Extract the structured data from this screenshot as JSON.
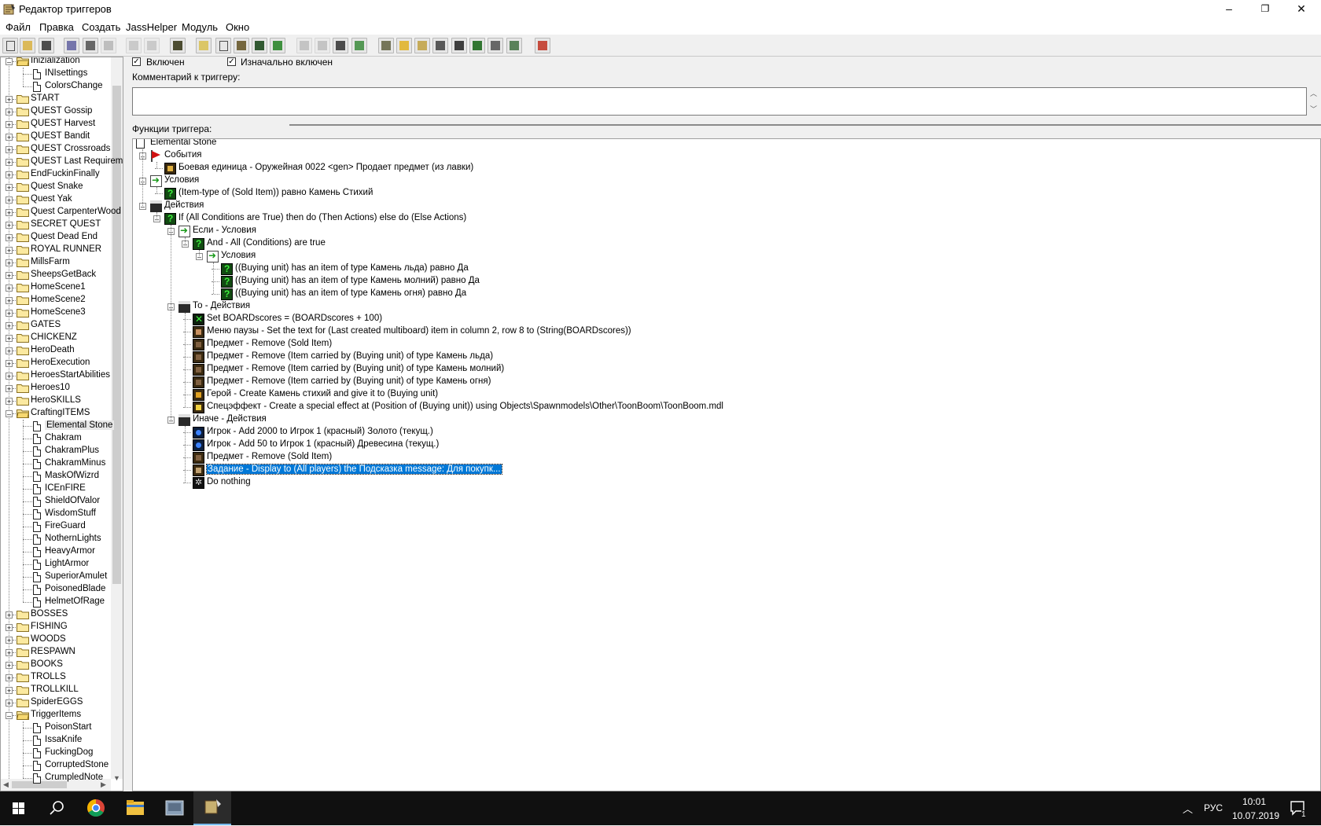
{
  "window": {
    "title": "Редактор триггеров",
    "min": "–",
    "max": "❐",
    "close": "✕"
  },
  "menu": [
    "Файл",
    "Правка",
    "Создать",
    "JassHelper",
    "Модуль",
    "Окно"
  ],
  "left_tree": {
    "items": [
      {
        "label": "Inizialization",
        "type": "folder",
        "depth": 0,
        "expanded": true
      },
      {
        "label": "INIsettings",
        "type": "doc",
        "depth": 1
      },
      {
        "label": "ColorsChange",
        "type": "doc",
        "depth": 1
      },
      {
        "label": "START",
        "type": "folder",
        "depth": 0
      },
      {
        "label": "QUEST Gossip",
        "type": "folder",
        "depth": 0
      },
      {
        "label": "QUEST Harvest",
        "type": "folder",
        "depth": 0
      },
      {
        "label": "QUEST Bandit",
        "type": "folder",
        "depth": 0
      },
      {
        "label": "QUEST Crossroads",
        "type": "folder",
        "depth": 0
      },
      {
        "label": "QUEST Last Requirement",
        "type": "folder",
        "depth": 0
      },
      {
        "label": "EndFuckinFinally",
        "type": "folder",
        "depth": 0
      },
      {
        "label": "Quest Snake",
        "type": "folder",
        "depth": 0
      },
      {
        "label": "Quest Yak",
        "type": "folder",
        "depth": 0
      },
      {
        "label": "Quest CarpenterWood",
        "type": "folder",
        "depth": 0
      },
      {
        "label": "SECRET QUEST",
        "type": "folder",
        "depth": 0
      },
      {
        "label": "Quest Dead End",
        "type": "folder",
        "depth": 0
      },
      {
        "label": "ROYAL RUNNER",
        "type": "folder",
        "depth": 0
      },
      {
        "label": "MillsFarm",
        "type": "folder",
        "depth": 0
      },
      {
        "label": "SheepsGetBack",
        "type": "folder",
        "depth": 0
      },
      {
        "label": "HomeScene1",
        "type": "folder",
        "depth": 0
      },
      {
        "label": "HomeScene2",
        "type": "folder",
        "depth": 0
      },
      {
        "label": "HomeScene3",
        "type": "folder",
        "depth": 0
      },
      {
        "label": "GATES",
        "type": "folder",
        "depth": 0
      },
      {
        "label": "CHICKENZ",
        "type": "folder",
        "depth": 0
      },
      {
        "label": "HeroDeath",
        "type": "folder",
        "depth": 0
      },
      {
        "label": "HeroExecution",
        "type": "folder",
        "depth": 0
      },
      {
        "label": "HeroesStartAbilities",
        "type": "folder",
        "depth": 0
      },
      {
        "label": "Heroes10",
        "type": "folder",
        "depth": 0
      },
      {
        "label": "HeroSKILLS",
        "type": "folder",
        "depth": 0
      },
      {
        "label": "CraftingITEMS",
        "type": "folder",
        "depth": 0,
        "expanded": true
      },
      {
        "label": "Elemental Stone",
        "type": "doc",
        "depth": 1,
        "selected": true
      },
      {
        "label": "Chakram",
        "type": "doc",
        "depth": 1
      },
      {
        "label": "ChakramPlus",
        "type": "doc",
        "depth": 1
      },
      {
        "label": "ChakramMinus",
        "type": "doc",
        "depth": 1
      },
      {
        "label": "MaskOfWizrd",
        "type": "doc",
        "depth": 1
      },
      {
        "label": "ICEnFIRE",
        "type": "doc",
        "depth": 1
      },
      {
        "label": "ShieldOfValor",
        "type": "doc",
        "depth": 1
      },
      {
        "label": "WisdomStuff",
        "type": "doc",
        "depth": 1
      },
      {
        "label": "FireGuard",
        "type": "doc",
        "depth": 1
      },
      {
        "label": "NothernLights",
        "type": "doc",
        "depth": 1
      },
      {
        "label": "HeavyArmor",
        "type": "doc",
        "depth": 1
      },
      {
        "label": "LightArmor",
        "type": "doc",
        "depth": 1
      },
      {
        "label": "SuperiorAmulet",
        "type": "doc",
        "depth": 1
      },
      {
        "label": "PoisonedBlade",
        "type": "doc",
        "depth": 1
      },
      {
        "label": "HelmetOfRage",
        "type": "doc",
        "depth": 1
      },
      {
        "label": "BOSSES",
        "type": "folder",
        "depth": 0
      },
      {
        "label": "FISHING",
        "type": "folder",
        "depth": 0
      },
      {
        "label": "WOODS",
        "type": "folder",
        "depth": 0
      },
      {
        "label": "RESPAWN",
        "type": "folder",
        "depth": 0
      },
      {
        "label": "BOOKS",
        "type": "folder",
        "depth": 0
      },
      {
        "label": "TROLLS",
        "type": "folder",
        "depth": 0
      },
      {
        "label": "TROLLKILL",
        "type": "folder",
        "depth": 0
      },
      {
        "label": "SpiderEGGS",
        "type": "folder",
        "depth": 0
      },
      {
        "label": "TriggerItems",
        "type": "folder",
        "depth": 0,
        "expanded": true
      },
      {
        "label": "PoisonStart",
        "type": "doc",
        "depth": 1
      },
      {
        "label": "IssaKnife",
        "type": "doc",
        "depth": 1
      },
      {
        "label": "FuckingDog",
        "type": "doc",
        "depth": 1
      },
      {
        "label": "CorruptedStone",
        "type": "doc",
        "depth": 1
      },
      {
        "label": "CrumpledNote",
        "type": "doc",
        "depth": 1
      }
    ]
  },
  "trigger": {
    "enabled_label": "Включен",
    "initially_enabled_label": "Изначально включен",
    "comment_label": "Комментарий к триггеру:",
    "functions_label": "Функции триггера:"
  },
  "functions": [
    {
      "label": "Elemental Stone",
      "icon": "doc",
      "depth": 0
    },
    {
      "label": "События",
      "icon": "flag",
      "depth": 1,
      "expander": "–"
    },
    {
      "label": "Боевая единица - Оружейная 0022 <gen> Продает предмет (из лавки)",
      "icon": "dark",
      "color": "#e0b040",
      "depth": 2
    },
    {
      "label": "Условия",
      "icon": "cond",
      "depth": 1,
      "expander": "–"
    },
    {
      "label": "(Item-type of (Sold Item)) равно Камень Стихий",
      "icon": "green",
      "depth": 2
    },
    {
      "label": "Действия",
      "icon": "clap",
      "depth": 1,
      "expander": "–"
    },
    {
      "label": "If (All Conditions are True) then do (Then Actions) else do (Else Actions)",
      "icon": "green",
      "depth": 2,
      "expander": "–"
    },
    {
      "label": "Если - Условия",
      "icon": "cond",
      "depth": 3,
      "expander": "–"
    },
    {
      "label": "And - All (Conditions) are true",
      "icon": "green",
      "depth": 4,
      "expander": "–"
    },
    {
      "label": "Условия",
      "icon": "cond",
      "depth": 5,
      "expander": "–"
    },
    {
      "label": "((Buying unit) has an item of type Камень льда) равно Да",
      "icon": "green",
      "depth": 6
    },
    {
      "label": "((Buying unit) has an item of type Камень молний) равно Да",
      "icon": "green",
      "depth": 6
    },
    {
      "label": "((Buying unit) has an item of type Камень огня) равно Да",
      "icon": "green",
      "depth": 6
    },
    {
      "label": "То - Действия",
      "icon": "clap",
      "depth": 3,
      "expander": "–"
    },
    {
      "label": "Set BOARDscores = (BOARDscores + 100)",
      "icon": "setv",
      "depth": 4
    },
    {
      "label": "Меню паузы - Set the text for (Last created multiboard) item in column 2, row 8 to (String(BOARDscores))",
      "icon": "dark",
      "color": "#c89060",
      "depth": 4
    },
    {
      "label": "Предмет - Remove (Sold Item)",
      "icon": "dark",
      "color": "#806040",
      "depth": 4
    },
    {
      "label": "Предмет - Remove (Item carried by (Buying unit) of type Камень льда)",
      "icon": "dark",
      "color": "#806040",
      "depth": 4
    },
    {
      "label": "Предмет - Remove (Item carried by (Buying unit) of type Камень молний)",
      "icon": "dark",
      "color": "#806040",
      "depth": 4
    },
    {
      "label": "Предмет - Remove (Item carried by (Buying unit) of type Камень огня)",
      "icon": "dark",
      "color": "#806040",
      "depth": 4
    },
    {
      "label": "Герой - Create Камень стихий and give it to (Buying unit)",
      "icon": "dark",
      "color": "#e0a020",
      "depth": 4
    },
    {
      "label": "Спецэффект - Create a special effect at (Position of (Buying unit)) using Objects\\Spawnmodels\\Other\\ToonBoom\\ToonBoom.mdl",
      "icon": "dark",
      "color": "#f0d040",
      "depth": 4
    },
    {
      "label": "Иначе - Действия",
      "icon": "clap",
      "depth": 3,
      "expander": "–"
    },
    {
      "label": "Игрок - Add 2000 to Игрок 1 (красный) Золото (текущ.)",
      "icon": "blue",
      "depth": 4
    },
    {
      "label": "Игрок - Add 50 to Игрок 1 (красный) Древесина (текущ.)",
      "icon": "blue",
      "depth": 4
    },
    {
      "label": "Предмет - Remove (Sold Item)",
      "icon": "dark",
      "color": "#806040",
      "depth": 4
    },
    {
      "label": "Задание - Display to (All players) the Подсказка message: Для покупк...",
      "icon": "dark",
      "color": "#c0a070",
      "depth": 4,
      "selected": true
    },
    {
      "label": "Do nothing",
      "icon": "nothing",
      "depth": 4
    }
  ],
  "taskbar": {
    "lang": "РУС",
    "time": "10:01",
    "date": "10.07.2019",
    "notifications": "1"
  }
}
